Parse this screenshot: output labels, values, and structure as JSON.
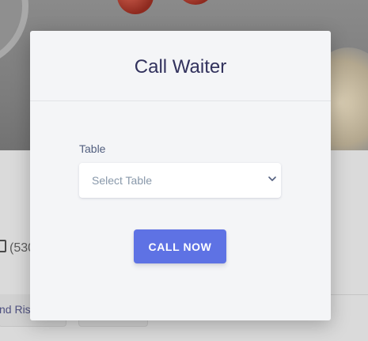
{
  "background": {
    "phone_text": "(530",
    "chip_1_text": "nd Ris",
    "chip_2_text": ""
  },
  "modal": {
    "title": "Call Waiter",
    "table_field": {
      "label": "Table",
      "selected_value": "Select Table",
      "icon": "chevron-down-icon"
    },
    "call_button_label": "CALL NOW"
  },
  "colors": {
    "accent": "#5e72e4",
    "title": "#32325d",
    "placeholder": "#8898aa",
    "modal_bg": "#f4f5f7"
  }
}
